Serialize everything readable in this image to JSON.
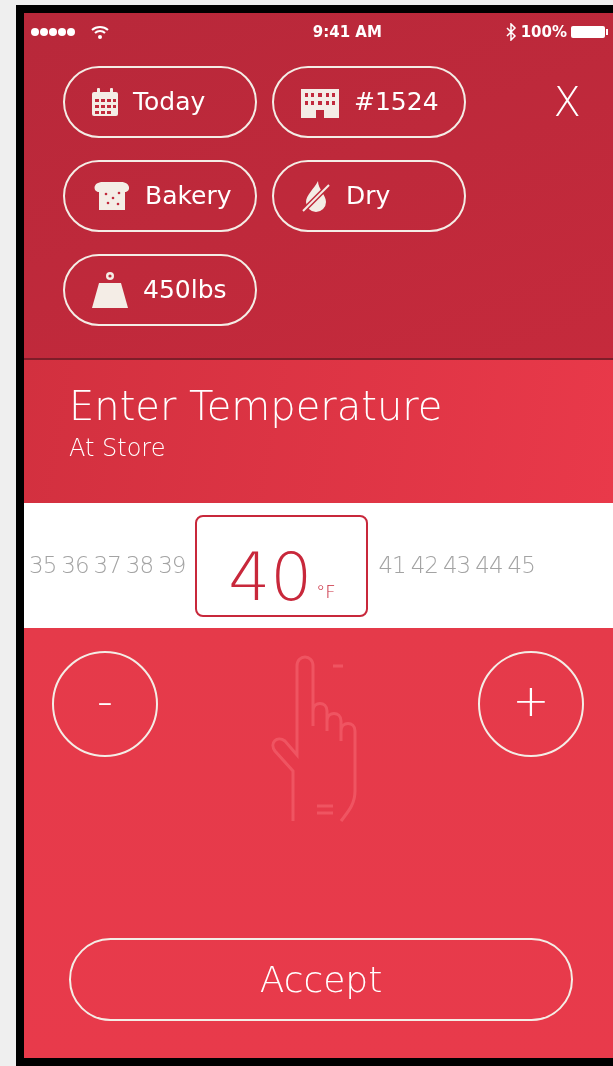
{
  "status_bar": {
    "time": "9:41 AM",
    "battery": "100%"
  },
  "chips": [
    {
      "kind": "calendar",
      "label": "Today"
    },
    {
      "kind": "building",
      "label": "#1524"
    },
    {
      "kind": "bread",
      "label": "Bakery"
    },
    {
      "kind": "nodrop",
      "label": "Dry"
    },
    {
      "kind": "weight",
      "label": "450lbs"
    }
  ],
  "close": "X",
  "title": "Enter Temperature",
  "subtitle": "At Store",
  "scale": [
    {
      "value": "35",
      "selected": false
    },
    {
      "value": "36",
      "selected": false
    },
    {
      "value": "37",
      "selected": false
    },
    {
      "value": "38",
      "selected": false
    },
    {
      "value": "39",
      "selected": false
    },
    {
      "value": "40",
      "selected": true,
      "unit": "°F"
    },
    {
      "value": "41",
      "selected": false
    },
    {
      "value": "42",
      "selected": false
    },
    {
      "value": "43",
      "selected": false
    },
    {
      "value": "44",
      "selected": false
    },
    {
      "value": "45",
      "selected": false
    }
  ],
  "decrease": "-",
  "increase": "+",
  "accept": "Accept"
}
